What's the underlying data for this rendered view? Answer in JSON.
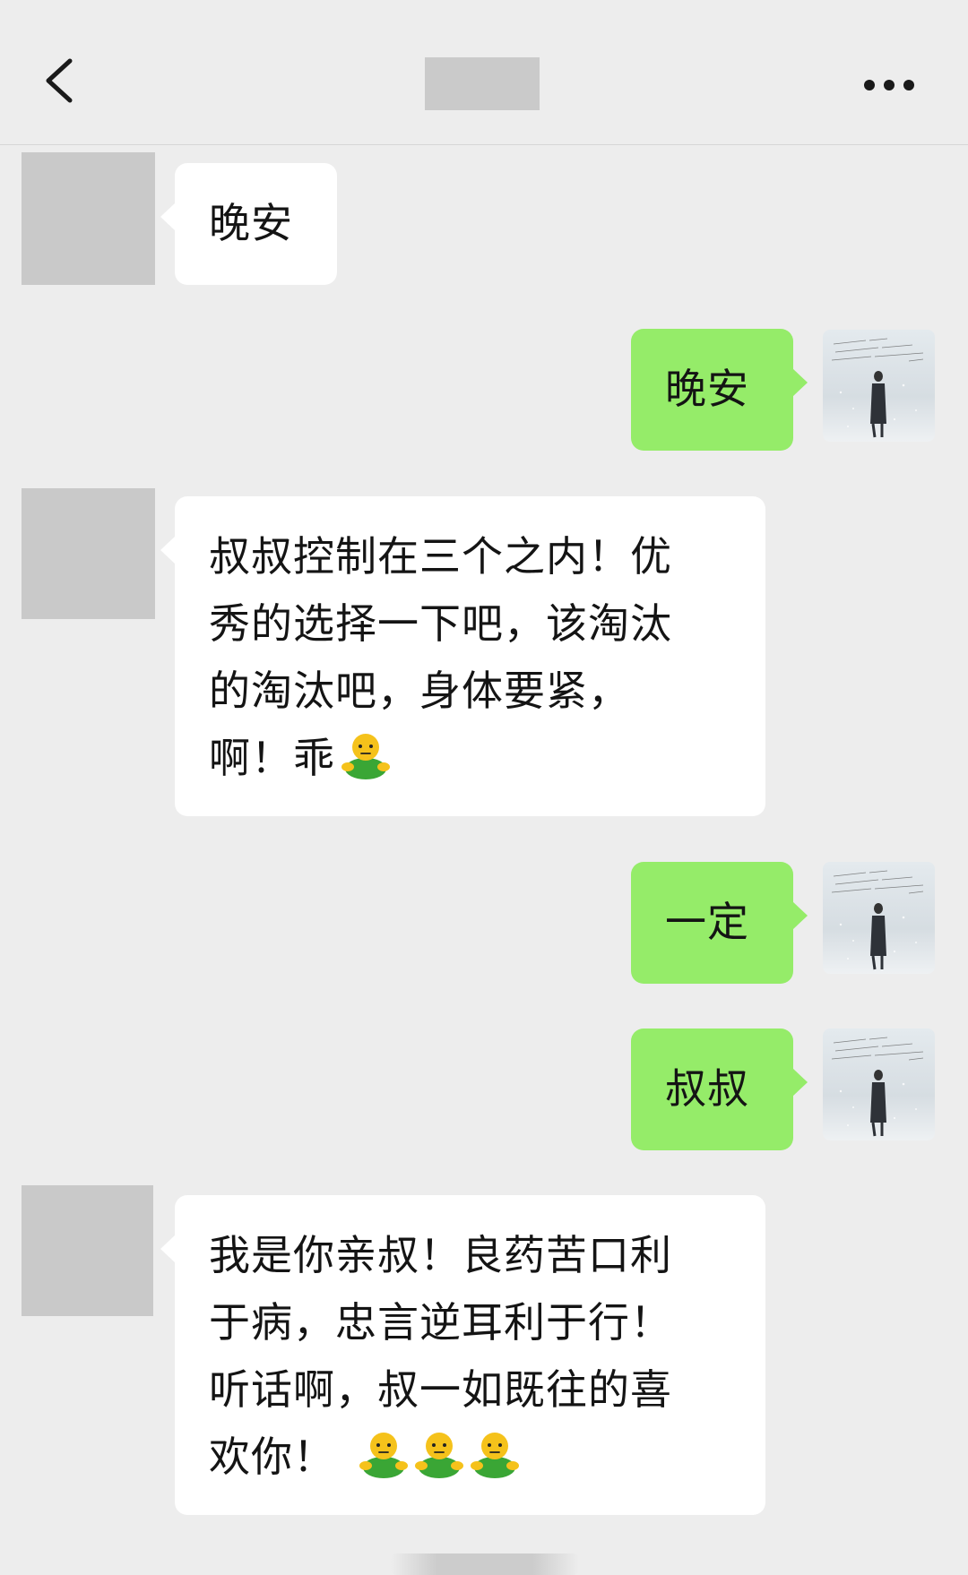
{
  "header": {
    "back_icon": "chevron-left-icon",
    "title": "",
    "more_icon": "more-dots-icon"
  },
  "messages": [
    {
      "from": "other",
      "text": "晚安"
    },
    {
      "from": "self",
      "text": "晚安"
    },
    {
      "from": "other",
      "lines": [
        "叔叔控制在三个之内！优",
        "秀的选择一下吧，该淘汰",
        "的淘汰吧，身体要紧，",
        "啊！乖"
      ],
      "emoji": "neutral-face-emoji"
    },
    {
      "from": "self",
      "text": "一定"
    },
    {
      "from": "self",
      "text": "叔叔"
    },
    {
      "from": "other",
      "lines": [
        "我是你亲叔！良药苦口利",
        "于病，忠言逆耳利于行！",
        "听话啊，叔一如既往的喜",
        "欢你！"
      ],
      "emoji_count": 3,
      "emoji": "neutral-face-emoji"
    }
  ],
  "colors": {
    "background": "#ededed",
    "incoming_bubble": "#ffffff",
    "outgoing_bubble": "#95ec69",
    "masked": "#c9c9c9"
  }
}
